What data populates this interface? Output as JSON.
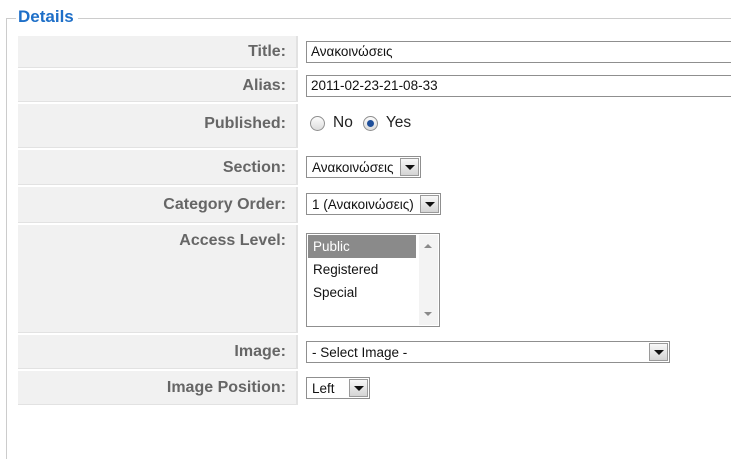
{
  "fieldset": {
    "legend": "Details"
  },
  "fields": {
    "title": {
      "label": "Title:",
      "value": "Ανακοινώσεις"
    },
    "alias": {
      "label": "Alias:",
      "value": "2011-02-23-21-08-33"
    },
    "published": {
      "label": "Published:",
      "options": [
        "No",
        "Yes"
      ],
      "selected": "Yes"
    },
    "section": {
      "label": "Section:",
      "value": "Ανακοινώσεις"
    },
    "category_order": {
      "label": "Category Order:",
      "value": "1 (Ανακοινώσεις)"
    },
    "access_level": {
      "label": "Access Level:",
      "options": [
        "Public",
        "Registered",
        "Special"
      ],
      "selected": "Public"
    },
    "image": {
      "label": "Image:",
      "value": "- Select Image -"
    },
    "image_position": {
      "label": "Image Position:",
      "value": "Left"
    }
  },
  "colors": {
    "legend": "#1e6fc8",
    "label_bg": "#f1f1f1",
    "selected_option_bg": "#8a8a8a"
  }
}
